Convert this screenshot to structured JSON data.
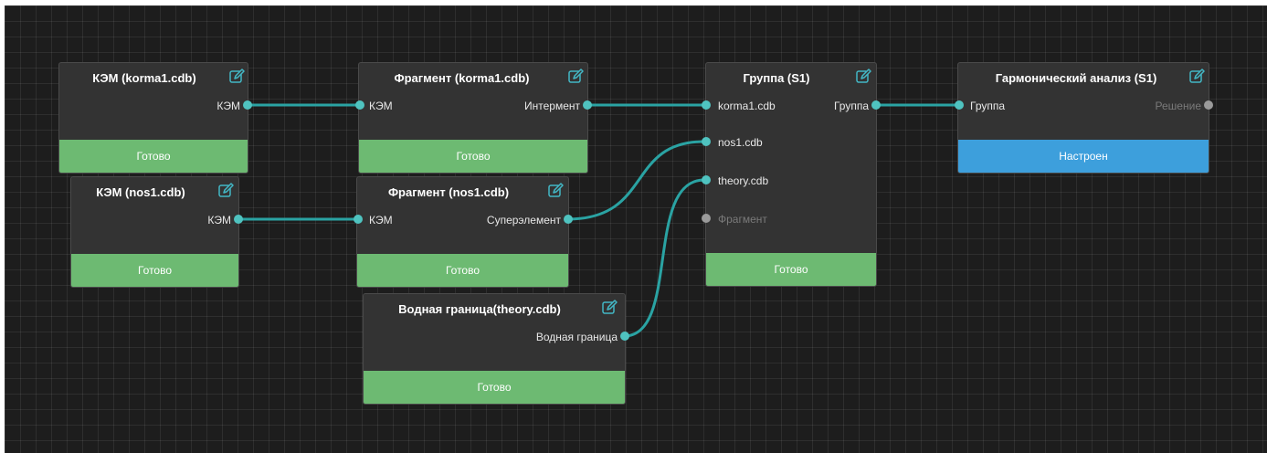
{
  "nodes": {
    "kem_korma": {
      "title": "КЭМ (korma1.cdb)",
      "out": "КЭМ",
      "status": "Готово"
    },
    "kem_nos": {
      "title": "КЭМ (nos1.cdb)",
      "out": "КЭМ",
      "status": "Готово"
    },
    "frag_korma": {
      "title": "Фрагмент (korma1.cdb)",
      "in": "КЭМ",
      "out": "Интермент",
      "status": "Готово"
    },
    "frag_nos": {
      "title": "Фрагмент (nos1.cdb)",
      "in": "КЭМ",
      "out": "Суперэлемент",
      "status": "Готово"
    },
    "water": {
      "title": "Водная граница(theory.cdb)",
      "out": "Водная граница",
      "status": "Готово"
    },
    "group": {
      "title": "Группа (S1)",
      "in1": "korma1.cdb",
      "in2": "nos1.cdb",
      "in3": "theory.cdb",
      "in4": "Фрагмент",
      "out": "Группа",
      "status": "Готово"
    },
    "harmonic": {
      "title": "Гармонический анализ (S1)",
      "in": "Группа",
      "out": "Решение",
      "status": "Настроен"
    }
  },
  "colors": {
    "canvas": "#1d1d1d",
    "node": "#333333",
    "status_ready": "#6dba72",
    "status_configured": "#3d9fdc",
    "wire": "#2aa3a3",
    "port": "#4fc3c0",
    "port_inactive": "#9a9a9a"
  },
  "icons": {
    "edit": "edit-pencil-icon"
  }
}
